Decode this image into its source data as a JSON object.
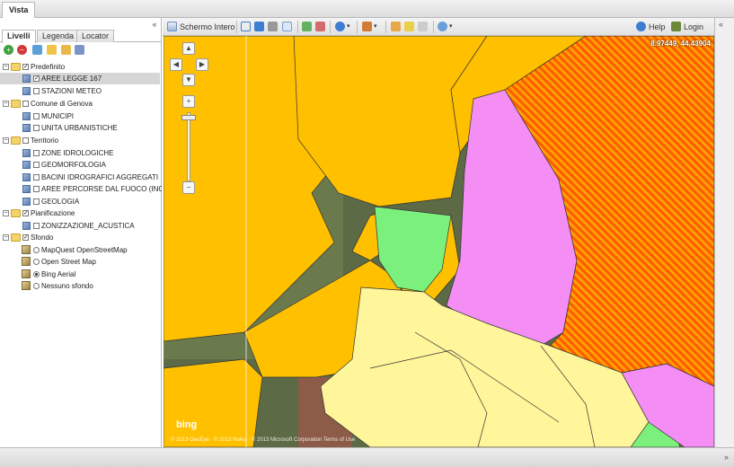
{
  "view_tab": "Vista",
  "left_panel": {
    "collapse_icon": "«",
    "tabs": [
      {
        "label": "Livelli",
        "active": true
      },
      {
        "label": "Legenda",
        "active": false
      },
      {
        "label": "Locator",
        "active": false
      }
    ],
    "toolbar_icons": [
      "add-layer-icon",
      "remove-layer-icon",
      "add-group-icon",
      "folder-add-icon",
      "folder-edit-icon",
      "settings-wrench-icon"
    ],
    "groups": [
      {
        "label": "Predefinito",
        "checked": true,
        "layers": [
          {
            "label": "AREE LEGGE 167",
            "checked": true,
            "selected": true
          },
          {
            "label": "STAZIONI METEO",
            "checked": false
          }
        ]
      },
      {
        "label": "Comune di Genova",
        "checked": false,
        "layers": [
          {
            "label": "MUNICIPI",
            "checked": false
          },
          {
            "label": "UNITA URBANISTICHE",
            "checked": false
          }
        ]
      },
      {
        "label": "Territorio",
        "checked": false,
        "layers": [
          {
            "label": "ZONE IDROLOGICHE",
            "checked": false
          },
          {
            "label": "GEOMORFOLOGIA",
            "checked": false
          },
          {
            "label": "BACINI IDROGRAFICI AGGREGATI",
            "checked": false
          },
          {
            "label": "AREE PERCORSE DAL FUOCO (INC",
            "checked": false
          },
          {
            "label": "GEOLOGIA",
            "checked": false
          }
        ]
      },
      {
        "label": "Pianificazione",
        "checked": true,
        "layers": [
          {
            "label": "ZONIZZAZIONE_ACUSTICA",
            "checked": false
          }
        ]
      },
      {
        "label": "Sfondo",
        "checked": true,
        "backgrounds": [
          {
            "label": "MapQuest OpenStreetMap",
            "selected": false
          },
          {
            "label": "Open Street Map",
            "selected": false
          },
          {
            "label": "Bing Aerial",
            "selected": true
          },
          {
            "label": "Nessuno sfondo",
            "selected": false
          }
        ]
      }
    ]
  },
  "map_toolbar": {
    "fullscreen_label": "Schermo Intero",
    "help_label": "Help",
    "login_label": "Login",
    "collapse_icon": "«"
  },
  "map": {
    "coordinates": "8.97449, 44.43904",
    "zoom_in": "+",
    "zoom_out": "−",
    "attribution_logo": "bing",
    "copyright": "© 2013 GeoEye · © 2013 Nokia · © 2013 Microsoft Corporation Terms of Use",
    "colors": {
      "orange": "#ffc000",
      "pink": "#f48ef4",
      "green": "#7cf07c",
      "yellow": "#fff59a",
      "hatch": "#ff6a00"
    }
  },
  "bottom_collapse": "»"
}
